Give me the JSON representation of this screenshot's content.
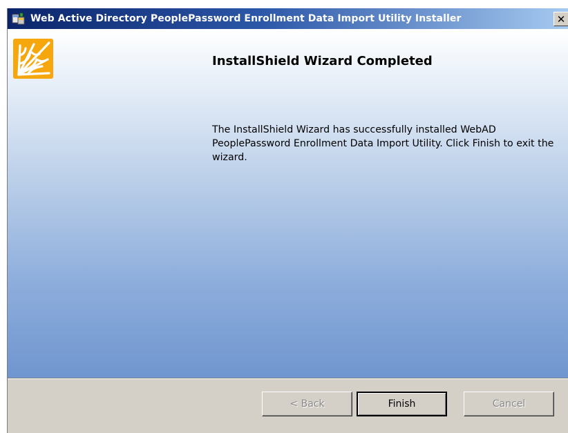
{
  "window": {
    "title": "Web Active Directory PeoplePassword Enrollment Data Import Utility Installer",
    "close_glyph": "✕",
    "icon": "installer-icon"
  },
  "main": {
    "logo_icon": "spider-web-icon",
    "logo_color": "#f6a70e",
    "heading": "InstallShield Wizard Completed",
    "message": "The InstallShield Wizard has successfully installed WebAD PeoplePassword Enrollment Data Import Utility. Click Finish to exit the wizard."
  },
  "buttons": {
    "back_label": "< Back",
    "finish_label": "Finish",
    "cancel_label": "Cancel",
    "back_enabled": false,
    "finish_enabled": true,
    "cancel_enabled": false
  }
}
